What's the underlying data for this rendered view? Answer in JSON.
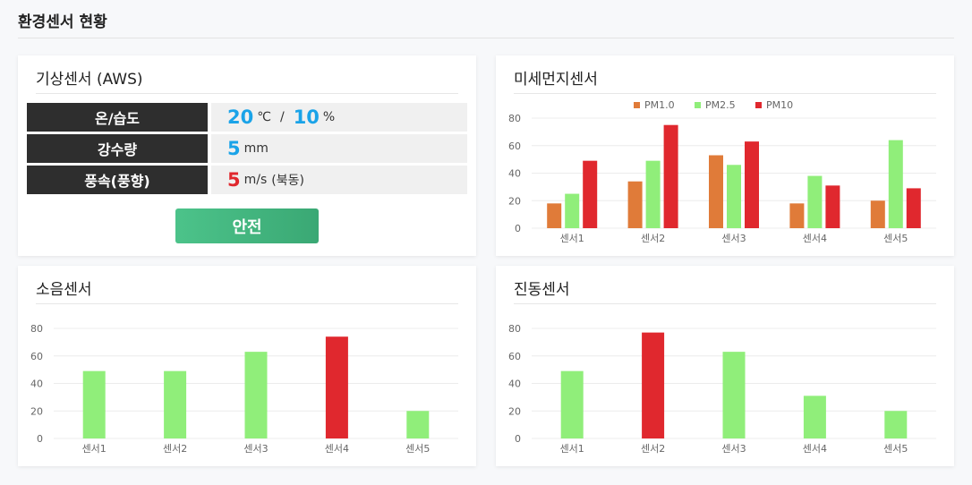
{
  "page": {
    "title": "환경센서 현황"
  },
  "aws": {
    "title": "기상센서 (AWS)",
    "rows": {
      "temp_humidity": {
        "label": "온/습도",
        "temp_value": "20",
        "temp_unit": "℃",
        "separator": "/",
        "humidity_value": "10",
        "humidity_unit": "%"
      },
      "rainfall": {
        "label": "강수량",
        "value": "5",
        "unit": "mm"
      },
      "wind": {
        "label": "풍속(풍향)",
        "value": "5",
        "unit": "m/s",
        "direction": "(북동)"
      }
    },
    "status": "안전"
  },
  "colors": {
    "pm1": "#e07b39",
    "pm25": "#90ee7a",
    "pm10": "#e0282e",
    "safe": "#90ee7a",
    "alert": "#e0282e"
  },
  "pm_chart": {
    "title": "미세먼지센서",
    "chart_data": {
      "type": "bar",
      "categories": [
        "센서1",
        "센서2",
        "센서3",
        "센서4",
        "센서5"
      ],
      "series": [
        {
          "name": "PM1.0",
          "values": [
            18,
            34,
            53,
            18,
            20
          ]
        },
        {
          "name": "PM2.5",
          "values": [
            25,
            49,
            46,
            38,
            64
          ]
        },
        {
          "name": "PM10",
          "values": [
            49,
            75,
            63,
            31,
            29
          ]
        }
      ],
      "yticks": [
        "80",
        "60",
        "40",
        "20",
        "0"
      ],
      "ylim": [
        0,
        80
      ],
      "legend": "top"
    }
  },
  "noise_chart": {
    "title": "소음센서",
    "chart_data": {
      "type": "bar",
      "categories": [
        "센서1",
        "센서2",
        "센서3",
        "센서4",
        "센서5"
      ],
      "values": [
        49,
        49,
        63,
        74,
        20
      ],
      "highlight_index": 3,
      "yticks": [
        "80",
        "60",
        "40",
        "20",
        "0"
      ],
      "ylim": [
        0,
        80
      ]
    }
  },
  "vib_chart": {
    "title": "진동센서",
    "chart_data": {
      "type": "bar",
      "categories": [
        "센서1",
        "센서2",
        "센서3",
        "센서4",
        "센서5"
      ],
      "values": [
        49,
        77,
        63,
        31,
        20
      ],
      "highlight_index": 1,
      "yticks": [
        "80",
        "60",
        "40",
        "20",
        "0"
      ],
      "ylim": [
        0,
        80
      ]
    }
  }
}
